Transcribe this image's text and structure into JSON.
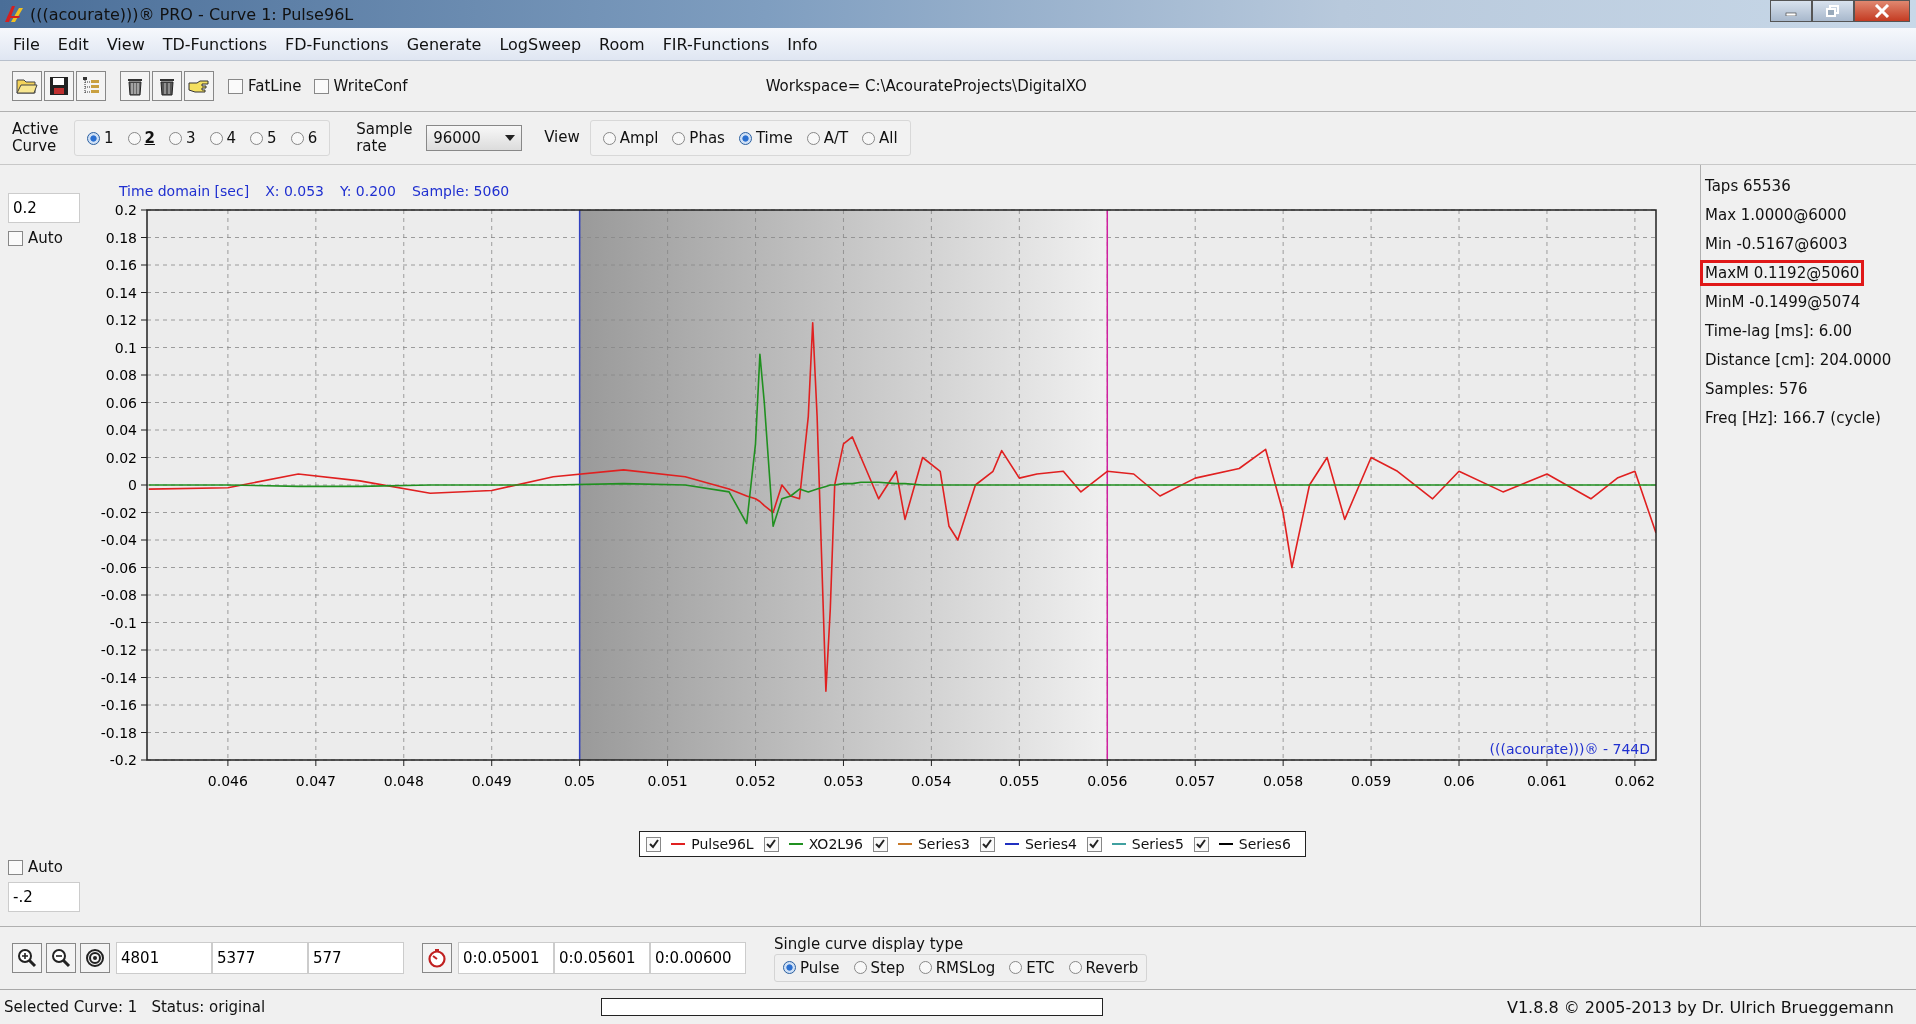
{
  "window": {
    "title": "(((acourate)))® PRO - Curve 1: Pulse96L"
  },
  "menu": [
    "File",
    "Edit",
    "View",
    "TD-Functions",
    "FD-Functions",
    "Generate",
    "LogSweep",
    "Room",
    "FIR-Functions",
    "Info"
  ],
  "toolbar": {
    "checkboxes": [
      {
        "label": "FatLine",
        "checked": false
      },
      {
        "label": "WriteConf",
        "checked": false
      }
    ],
    "workspace": "Workspace= C:\\AcourateProjects\\DigitalXO"
  },
  "active_curve": {
    "label": "Active Curve",
    "options": [
      {
        "label": "1",
        "selected": true,
        "emphasized": false
      },
      {
        "label": "2",
        "selected": false,
        "emphasized": true
      },
      {
        "label": "3",
        "selected": false,
        "emphasized": false
      },
      {
        "label": "4",
        "selected": false,
        "emphasized": false
      },
      {
        "label": "5",
        "selected": false,
        "emphasized": false
      },
      {
        "label": "6",
        "selected": false,
        "emphasized": false
      }
    ]
  },
  "sample_rate": {
    "label": "Sample rate",
    "value": "96000"
  },
  "view": {
    "label": "View",
    "options": [
      {
        "label": "Ampl",
        "selected": false
      },
      {
        "label": "Phas",
        "selected": false
      },
      {
        "label": "Time",
        "selected": true
      },
      {
        "label": "A/T",
        "selected": false
      },
      {
        "label": "All",
        "selected": false
      }
    ]
  },
  "chart": {
    "y_max": "0.2",
    "auto_top": {
      "label": "Auto",
      "checked": false
    },
    "auto_bottom": {
      "label": "Auto",
      "checked": false
    },
    "y_min": "-.2",
    "header": [
      "Time domain [sec]",
      "X: 0.053",
      "Y: 0.200",
      "Sample: 5060"
    ],
    "plot_label": "(((acourate)))® - 744D",
    "chart_data": {
      "type": "line",
      "xlim": [
        0.04508,
        0.06224
      ],
      "ylim": [
        -0.2,
        0.2
      ],
      "xticks": [
        0.046,
        0.047,
        0.048,
        0.049,
        0.05,
        0.051,
        0.052,
        0.053,
        0.054,
        0.055,
        0.056,
        0.057,
        0.058,
        0.059,
        0.06,
        0.061,
        0.062
      ],
      "yticks": [
        0.2,
        0.18,
        0.16,
        0.14,
        0.12,
        0.1,
        0.08,
        0.06,
        0.04,
        0.02,
        0,
        -0.02,
        -0.04,
        -0.06,
        -0.08,
        -0.1,
        -0.12,
        -0.14,
        -0.16,
        -0.18,
        -0.2
      ],
      "grid": true,
      "bands": [
        {
          "axis": "x",
          "from": 0.05,
          "to": 0.056
        }
      ],
      "ref_lines": [
        {
          "axis": "x",
          "value": 0.05,
          "color": "#3040c0"
        },
        {
          "axis": "x",
          "value": 0.056,
          "color": "#d020a0"
        }
      ],
      "x": [
        0.0451,
        0.046,
        0.0468,
        0.0475,
        0.0483,
        0.049,
        0.0497,
        0.0505,
        0.0512,
        0.0517,
        0.0519,
        0.052,
        0.05205,
        0.0521,
        0.0522,
        0.0523,
        0.0524,
        0.0525,
        0.0526,
        0.05265,
        0.0527,
        0.05275,
        0.0528,
        0.05285,
        0.0529,
        0.053,
        0.0531,
        0.0532,
        0.0534,
        0.0536,
        0.0537,
        0.0539,
        0.0541,
        0.0542,
        0.0543,
        0.0545,
        0.0547,
        0.0548,
        0.055,
        0.0552,
        0.0555,
        0.0557,
        0.056,
        0.0563,
        0.0566,
        0.057,
        0.0575,
        0.0578,
        0.058,
        0.0581,
        0.0583,
        0.0585,
        0.0587,
        0.059,
        0.0593,
        0.0597,
        0.06,
        0.0605,
        0.061,
        0.0615,
        0.0618,
        0.062,
        0.06224
      ],
      "series": [
        {
          "name": "Pulse96L",
          "color": "#e02020",
          "values": [
            -0.003,
            -0.002,
            0.008,
            0.003,
            -0.006,
            -0.004,
            0.006,
            0.011,
            0.006,
            -0.003,
            -0.008,
            -0.01,
            -0.012,
            -0.015,
            -0.02,
            0.0,
            -0.008,
            -0.01,
            0.05,
            0.118,
            0.05,
            -0.05,
            -0.15,
            -0.09,
            0.0,
            0.03,
            0.035,
            0.02,
            -0.01,
            0.01,
            -0.025,
            0.02,
            0.01,
            -0.03,
            -0.04,
            0.0,
            0.01,
            0.025,
            0.005,
            0.008,
            0.01,
            -0.005,
            0.01,
            0.008,
            -0.008,
            0.005,
            0.012,
            0.026,
            -0.02,
            -0.06,
            0.0,
            0.02,
            -0.025,
            0.02,
            0.01,
            -0.01,
            0.01,
            -0.005,
            0.008,
            -0.01,
            0.005,
            0.01,
            -0.035
          ]
        },
        {
          "name": "XO2L96",
          "color": "#209020",
          "values": [
            0,
            0,
            -0.001,
            -0.001,
            0,
            0,
            0,
            0.001,
            0,
            -0.005,
            -0.028,
            0.03,
            0.095,
            0.06,
            -0.03,
            -0.01,
            -0.008,
            -0.003,
            -0.005,
            -0.004,
            -0.003,
            -0.002,
            -0.001,
            0,
            0,
            0.001,
            0.001,
            0.002,
            0.002,
            0.001,
            0.001,
            0,
            0,
            0,
            0,
            0,
            0,
            0,
            0,
            0,
            0,
            0,
            0,
            0,
            0,
            0,
            0,
            0,
            0,
            0,
            0,
            0,
            0,
            0,
            0,
            0,
            0,
            0,
            0,
            0,
            0,
            0,
            0
          ]
        },
        {
          "name": "Series3",
          "color": "#c87a2a",
          "values": [
            null,
            null,
            null,
            null,
            null,
            null,
            null,
            null,
            null,
            null,
            null,
            null,
            null,
            null,
            null,
            null,
            null,
            null,
            null,
            null,
            null,
            null,
            null,
            null,
            null,
            null,
            null,
            null,
            null,
            null,
            null,
            null,
            null,
            null,
            null,
            null,
            null,
            null,
            null,
            null,
            null,
            null,
            null,
            null,
            null,
            null,
            null,
            null,
            null,
            null,
            null,
            null,
            null,
            null,
            null,
            null,
            null,
            null,
            null,
            null,
            null,
            null,
            null
          ]
        },
        {
          "name": "Series4",
          "color": "#2030c0",
          "values": [
            null,
            null,
            null,
            null,
            null,
            null,
            null,
            null,
            null,
            null,
            null,
            null,
            null,
            null,
            null,
            null,
            null,
            null,
            null,
            null,
            null,
            null,
            null,
            null,
            null,
            null,
            null,
            null,
            null,
            null,
            null,
            null,
            null,
            null,
            null,
            null,
            null,
            null,
            null,
            null,
            null,
            null,
            null,
            null,
            null,
            null,
            null,
            null,
            null,
            null,
            null,
            null,
            null,
            null,
            null,
            null,
            null,
            null,
            null,
            null,
            null,
            null,
            null
          ]
        },
        {
          "name": "Series5",
          "color": "#40a0a0",
          "values": [
            null,
            null,
            null,
            null,
            null,
            null,
            null,
            null,
            null,
            null,
            null,
            null,
            null,
            null,
            null,
            null,
            null,
            null,
            null,
            null,
            null,
            null,
            null,
            null,
            null,
            null,
            null,
            null,
            null,
            null,
            null,
            null,
            null,
            null,
            null,
            null,
            null,
            null,
            null,
            null,
            null,
            null,
            null,
            null,
            null,
            null,
            null,
            null,
            null,
            null,
            null,
            null,
            null,
            null,
            null,
            null,
            null,
            null,
            null,
            null,
            null,
            null,
            null
          ]
        },
        {
          "name": "Series6",
          "color": "#000000",
          "values": [
            null,
            null,
            null,
            null,
            null,
            null,
            null,
            null,
            null,
            null,
            null,
            null,
            null,
            null,
            null,
            null,
            null,
            null,
            null,
            null,
            null,
            null,
            null,
            null,
            null,
            null,
            null,
            null,
            null,
            null,
            null,
            null,
            null,
            null,
            null,
            null,
            null,
            null,
            null,
            null,
            null,
            null,
            null,
            null,
            null,
            null,
            null,
            null,
            null,
            null,
            null,
            null,
            null,
            null,
            null,
            null,
            null,
            null,
            null,
            null,
            null,
            null,
            null
          ]
        }
      ]
    },
    "legend_checked": [
      true,
      true,
      true,
      true,
      true,
      true
    ]
  },
  "info": [
    {
      "text": "Taps 65536",
      "highlighted": false
    },
    {
      "text": "Max 1.0000@6000",
      "highlighted": false
    },
    {
      "text": "Min -0.5167@6003",
      "highlighted": false
    },
    {
      "text": "MaxM 0.1192@5060",
      "highlighted": true
    },
    {
      "text": "MinM -0.1499@5074",
      "highlighted": false
    },
    {
      "text": "Time-lag [ms]: 6.00",
      "highlighted": false
    },
    {
      "text": "Distance [cm]: 204.0000",
      "highlighted": false
    },
    {
      "text": "Samples:  576",
      "highlighted": false
    },
    {
      "text": "Freq [Hz]: 166.7 (cycle)",
      "highlighted": false
    }
  ],
  "bottom": {
    "range_fields": [
      "4801",
      "5377",
      "577"
    ],
    "time_fields": [
      "0:0.05001",
      "0:0.05601",
      "0:0.00600"
    ],
    "display_type": {
      "title": "Single curve display type",
      "options": [
        {
          "label": "Pulse",
          "selected": true
        },
        {
          "label": "Step",
          "selected": false
        },
        {
          "label": "RMSLog",
          "selected": false
        },
        {
          "label": "ETC",
          "selected": false
        },
        {
          "label": "Reverb",
          "selected": false
        }
      ]
    }
  },
  "status_bar": {
    "selected": "Selected Curve: 1",
    "status": "Status: original",
    "progress": {
      "level": 0
    },
    "copyright": "V1.8.8 © 2005-2013 by Dr. Ulrich Brueggemann"
  }
}
